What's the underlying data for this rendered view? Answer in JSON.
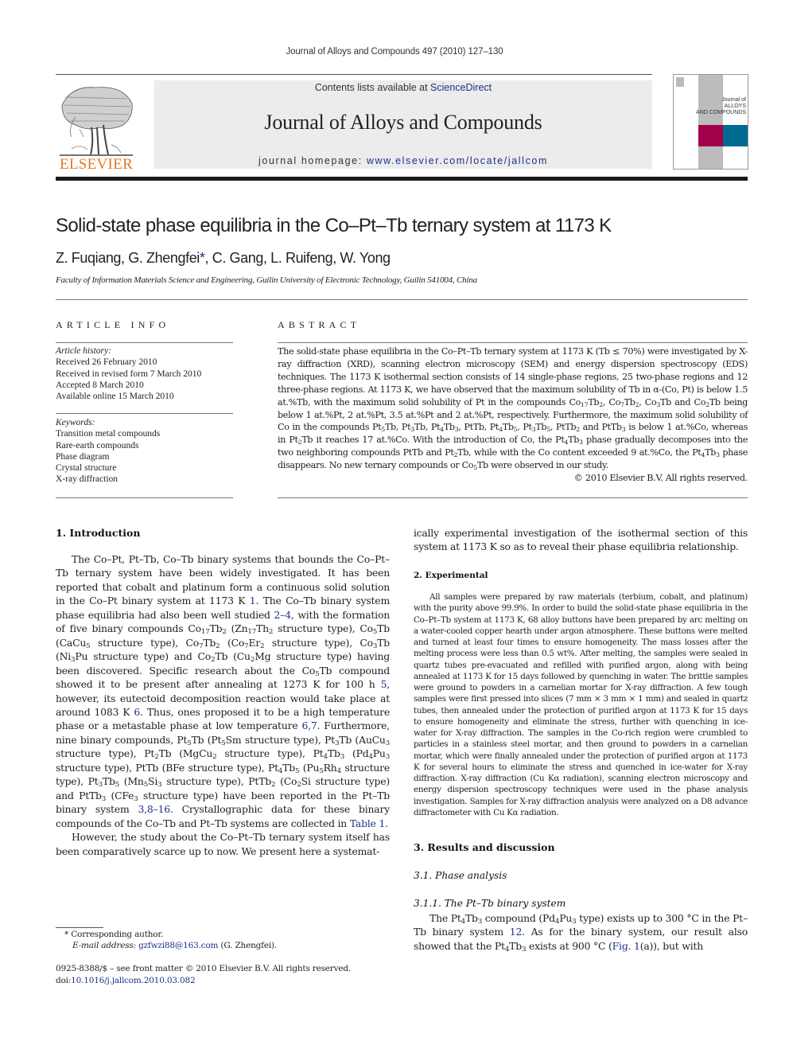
{
  "header": {
    "running_head": "Journal of Alloys and Compounds 497 (2010) 127–130",
    "contents_prefix": "Contents lists available at ",
    "contents_link": "ScienceDirect",
    "journal_name": "Journal of Alloys and Compounds",
    "homepage_prefix": "journal homepage: ",
    "homepage_link": "www.elsevier.com/locate/jallcom",
    "publisher_logo_text": "ELSEVIER",
    "cover_text": [
      "Journal of",
      "ALLOYS",
      "AND COMPOUNDS"
    ],
    "colors": {
      "elsevier_orange": "#e87722",
      "link_blue": "#1f2f8a",
      "cover_magenta": "#a3004b",
      "cover_teal": "#006b8f",
      "masthead_grey": "#ececec"
    }
  },
  "article": {
    "title": "Solid-state phase equilibria in the Co–Pt–Tb ternary system at 1173 K",
    "authors_before": "Z. Fuqiang, G. Zhengfei",
    "corresponding_mark": "*",
    "authors_after": ", C. Gang, L. Ruifeng, W. Yong",
    "affiliation": "Faculty of Information Materials Science and Engineering, Guilin University of Electronic Technology, Guilin 541004, China"
  },
  "article_info": {
    "heading": "ARTICLE INFO",
    "history_label": "Article history:",
    "history": [
      "Received 26 February 2010",
      "Received in revised form 7 March 2010",
      "Accepted 8 March 2010",
      "Available online 15 March 2010"
    ],
    "keywords_label": "Keywords:",
    "keywords": [
      "Transition metal compounds",
      "Rare-earth compounds",
      "Phase diagram",
      "Crystal structure",
      "X-ray diffraction"
    ]
  },
  "abstract": {
    "heading": "ABSTRACT",
    "text": "The solid-state phase equilibria in the Co–Pt–Tb ternary system at 1173 K (Tb ≤ 70%) were investigated by X-ray diffraction (XRD), scanning electron microscopy (SEM) and energy dispersion spectroscopy (EDS) techniques. The 1173 K isothermal section consists of 14 single-phase regions, 25 two-phase regions and 12 three-phase regions. At 1173 K, we have observed that the maximum solubility of Tb in α-(Co, Pt) is below 1.5 at.%Tb, with the maximum solid solubility of Pt in the compounds Co_{17}Tb_{2}, Co_{7}Tb_{2}, Co_{3}Tb and Co_{2}Tb being below 1 at.%Pt, 2 at.%Pt, 3.5 at.%Pt and 2 at.%Pt, respectively. Furthermore, the maximum solid solubility of Co in the compounds Pt_{5}Tb, Pt_{3}Tb, Pt_{4}Tb_{3}, PtTb, Pt_{4}Tb_{5}, Pt_{3}Tb_{5}, PtTb_{2} and PtTb_{3} is below 1 at.%Co, whereas in Pt_{2}Tb it reaches 17 at.%Co. With the introduction of Co, the Pt_{4}Tb_{3} phase gradually decomposes into the two neighboring compounds PtTb and Pt_{2}Tb, while with the Co content exceeded 9 at.%Co, the Pt_{4}Tb_{3} phase disappears. No new ternary compounds or Co_{5}Tb were observed in our study.",
    "copyright": "© 2010 Elsevier B.V. All rights reserved."
  },
  "sections": {
    "introduction": {
      "heading": "1.  Introduction",
      "paragraphs": [
        "The Co–Pt, Pt–Tb, Co–Tb binary systems that bounds the Co–Pt–Tb ternary system have been widely investigated. It has been reported that cobalt and platinum form a continuous solid solution in the Co–Pt binary system at 1173 K [[1]]. The Co–Tb binary system phase equilibria had also been well studied [[2–4]], with the formation of five binary compounds Co_{17}Tb_{2} (Zn_{17}Th_{2} structure type), Co_{5}Tb (CaCu_{5} structure type), Co_{7}Tb_{2} (Co_{7}Er_{2} structure type), Co_{3}Tb (Ni_{3}Pu structure type) and Co_{2}Tb (Cu_{2}Mg structure type) having been discovered. Specific research about the Co_{5}Tb compound showed it to be present after annealing at 1273 K for 100 h [[5]], however, its eutectoid decomposition reaction would take place at around 1083 K [[6]]. Thus, ones proposed it to be a high temperature phase or a metastable phase at low temperature [[6,7]]. Furthermore, nine binary compounds, Pt_{5}Tb (Pt_{5}Sm structure type), Pt_{3}Tb (AuCu_{3} structure type), Pt_{2}Tb (MgCu_{2} structure type), Pt_{4}Tb_{3} (Pd_{4}Pu_{3} structure type), PtTb (BFe structure type), Pt_{4}Tb_{5} (Pu_{5}Rh_{4} structure type), Pt_{3}Tb_{5} (Mn_{5}Si_{3} structure type), PtTb_{2} (Co_{2}Si structure type) and PtTb_{3} (CFe_{3} structure type) have been reported in the Pt–Tb binary system [[3,8–16]]. Crystallographic data for these binary compounds of the Co–Tb and Pt–Tb systems are collected in [[Table 1]].",
        "However, the study about the Co–Pt–Tb ternary system itself has been comparatively scarce up to now. We present here a systemat-"
      ],
      "continuation": "ically experimental investigation of the isothermal section of this system at 1173 K so as to reveal their phase equilibria relationship."
    },
    "experimental": {
      "heading": "2.  Experimental",
      "paragraphs": [
        "All samples were prepared by raw materials (terbium, cobalt, and platinum) with the purity above 99.9%. In order to build the solid-state phase equilibria in the Co–Pt–Tb system at 1173 K, 68 alloy buttons have been prepared by arc melting on a water-cooled copper hearth under argon atmosphere. These buttons were melted and turned at least four times to ensure homogeneity. The mass losses after the melting process were less than 0.5 wt%. After melting, the samples were sealed in quartz tubes pre-evacuated and refilled with purified argon, along with being annealed at 1173 K for 15 days followed by quenching in water. The brittle samples were ground to powders in a carnelian mortar for X-ray diffraction. A few tough samples were first pressed into slices (7 mm × 3 mm × 1 mm) and sealed in quartz tubes, then annealed under the protection of purified argon at 1173 K for 15 days to ensure homogeneity and eliminate the stress, further with quenching in ice-water for X-ray diffraction. The samples in the Co-rich region were crumbled to particles in a stainless steel mortar, and then ground to powders in a carnelian mortar, which were finally annealed under the protection of purified argon at 1173 K for several hours to eliminate the stress and quenched in ice-water for X-ray diffraction. X-ray diffraction (Cu Kα radiation), scanning electron microscopy and energy dispersion spectroscopy techniques were used in the phase analysis investigation. Samples for X-ray diffraction analysis were analyzed on a D8 advance diffractometer with Cu Kα radiation."
      ]
    },
    "results": {
      "heading": "3.  Results and discussion",
      "sub_heading": "3.1.  Phase analysis",
      "subsub_heading": "3.1.1.  The Pt–Tb binary system",
      "paragraphs": [
        "The Pt_{4}Tb_{3} compound (Pd_{4}Pu_{3} type) exists up to 300 °C in the Pt–Tb binary system [[12]]. As for the binary system, our result also showed that the Pt_{4}Tb_{3} exists at 900 °C ([[Fig. 1]](a)), but with"
      ]
    }
  },
  "footnotes": {
    "corresponding": "* Corresponding author.",
    "email_label": "E-mail address: ",
    "email": "gzfwzi88@163.com",
    "email_owner": " (G. Zhengfei).",
    "front_matter": "0925-8388/$ – see front matter © 2010 Elsevier B.V. All rights reserved.",
    "doi_prefix": "doi:",
    "doi": "10.1016/j.jallcom.2010.03.082"
  }
}
